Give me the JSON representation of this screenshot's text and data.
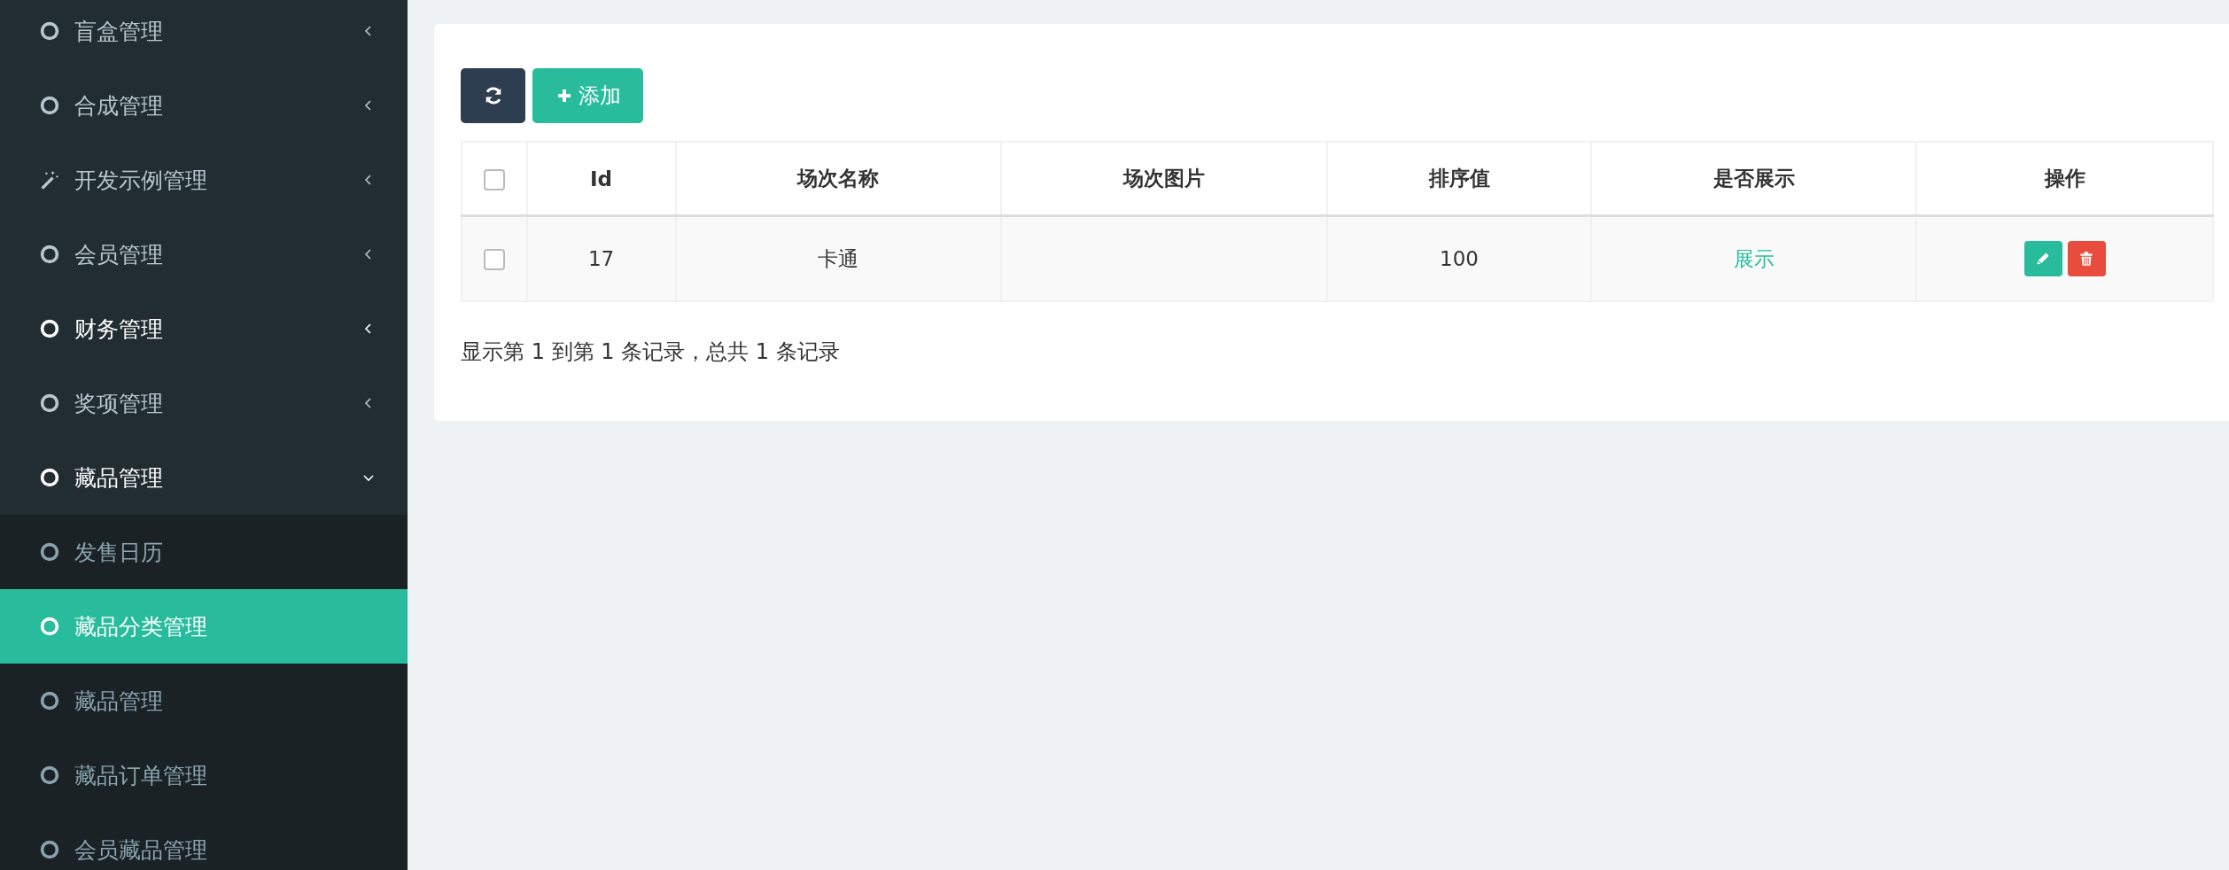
{
  "sidebar": {
    "items": [
      {
        "label": "盲盒管理",
        "kind": "circle",
        "highlighted": false,
        "expanded": false
      },
      {
        "label": "合成管理",
        "kind": "circle",
        "highlighted": false,
        "expanded": false
      },
      {
        "label": "开发示例管理",
        "kind": "wand",
        "highlighted": false,
        "expanded": false
      },
      {
        "label": "会员管理",
        "kind": "circle",
        "highlighted": false,
        "expanded": false
      },
      {
        "label": "财务管理",
        "kind": "circle",
        "highlighted": true,
        "expanded": false
      },
      {
        "label": "奖项管理",
        "kind": "circle",
        "highlighted": false,
        "expanded": false
      },
      {
        "label": "藏品管理",
        "kind": "circle",
        "highlighted": true,
        "expanded": true,
        "children": [
          {
            "label": "发售日历",
            "selected": false
          },
          {
            "label": "藏品分类管理",
            "selected": true
          },
          {
            "label": "藏品管理",
            "selected": false
          },
          {
            "label": "藏品订单管理",
            "selected": false
          },
          {
            "label": "会员藏品管理",
            "selected": false
          }
        ]
      }
    ]
  },
  "toolbar": {
    "add_button": "添加"
  },
  "table": {
    "columns": [
      "Id",
      "场次名称",
      "场次图片",
      "排序值",
      "是否展示",
      "操作"
    ],
    "header_checked": false,
    "rows": [
      {
        "checked": false,
        "id": "17",
        "name": "卡通",
        "sort": "100",
        "display": "展示",
        "shown": true
      }
    ]
  },
  "footer": "显示第 1 到第 1 条记录，总共 1 条记录"
}
